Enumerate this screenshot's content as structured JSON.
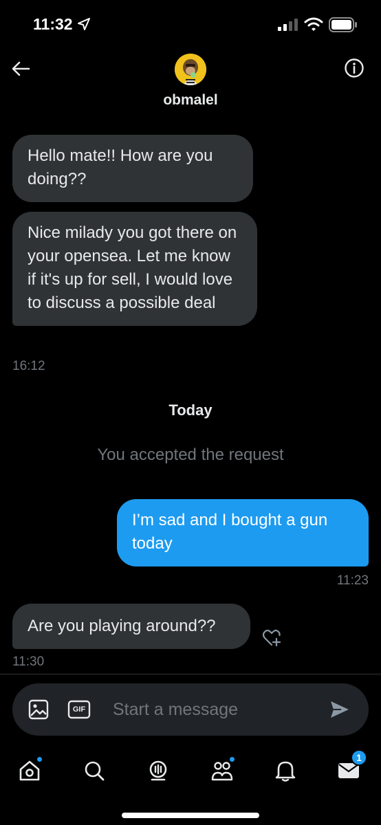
{
  "status_bar": {
    "time": "11:32",
    "icons": [
      "location-arrow-icon",
      "cellular-signal-icon",
      "wifi-icon",
      "battery-icon"
    ]
  },
  "header": {
    "name": "obmalel",
    "back_icon": "back-arrow-icon",
    "info_icon": "info-icon"
  },
  "conversation": {
    "messages": [
      {
        "direction": "incoming",
        "text": "Hello mate!! How are you doing??"
      },
      {
        "direction": "incoming",
        "text": "Nice milady you got there on your opensea. Let me know if it's up for sell, I would love to discuss a possible deal",
        "time": "16:12"
      },
      {
        "direction": "outgoing",
        "text": "I’m sad and I bought a gun today",
        "time": "11:23"
      },
      {
        "direction": "incoming",
        "text": "Are you playing around??",
        "time": "11:30"
      }
    ],
    "day_separator": "Today",
    "system_note": "You accepted the request"
  },
  "composer": {
    "placeholder": "Start a message",
    "gif_label": "GIF"
  },
  "tabbar": {
    "tabs": [
      "home",
      "search",
      "spaces",
      "communities",
      "notifications",
      "messages"
    ],
    "messages_badge": "1"
  },
  "colors": {
    "background": "#000000",
    "incoming_bubble": "#2f3336",
    "outgoing_bubble": "#1d9bf0",
    "muted_text": "#71767b",
    "avatar_bg": "#f0c21b"
  }
}
